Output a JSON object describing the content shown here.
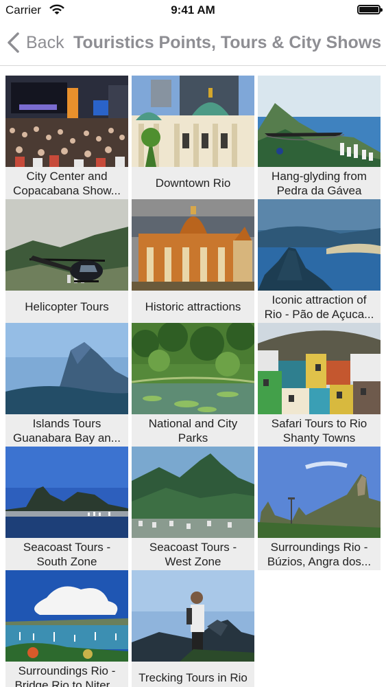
{
  "status_bar": {
    "carrier": "Carrier",
    "time": "9:41 AM",
    "wifi_icon": "wifi-icon",
    "battery_icon": "battery-icon"
  },
  "nav": {
    "back_label": "Back",
    "back_icon": "chevron-left-icon",
    "title": "Touristics Points, Tours & City Shows"
  },
  "tiles": [
    {
      "label": "City Center and\nCopacabana Show...",
      "image": "concert-crowd"
    },
    {
      "label": "Downtown Rio",
      "image": "theatre-building"
    },
    {
      "label": "Hang-glyding from\nPedra da Gávea",
      "image": "hang-glider-coast"
    },
    {
      "label": "Helicopter Tours",
      "image": "helicopter"
    },
    {
      "label": "Historic attractions",
      "image": "historic-palace"
    },
    {
      "label": "Iconic attraction of\nRio - Pão de Açuca...",
      "image": "sugarloaf-bay"
    },
    {
      "label": "Islands Tours\nGuanabara Bay an...",
      "image": "mountain-sky"
    },
    {
      "label": "National and City\nParks",
      "image": "park-pond"
    },
    {
      "label": "Safari Tours to Rio\nShanty Towns",
      "image": "favela-houses"
    },
    {
      "label": "Seacoast Tours -\nSouth Zone",
      "image": "south-zone-bay"
    },
    {
      "label": "Seacoast Tours -\nWest Zone",
      "image": "west-zone-mountain"
    },
    {
      "label": "Surroundings  Rio -\nBúzios, Angra dos...",
      "image": "mountain-peaks"
    },
    {
      "label": "Surroundings Rio -\nBridge Rio to Niter...",
      "image": "bay-boats"
    },
    {
      "label": "Trecking Tours in Rio",
      "image": "hiker"
    }
  ]
}
